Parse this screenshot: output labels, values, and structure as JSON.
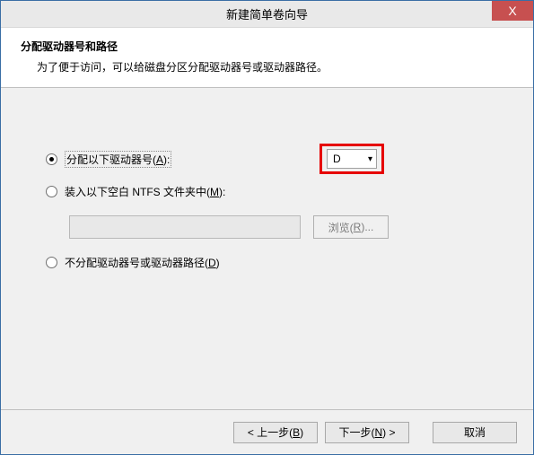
{
  "window": {
    "title": "新建简单卷向导",
    "close_glyph": "X"
  },
  "header": {
    "title": "分配驱动器号和路径",
    "subtitle": "为了便于访问，可以给磁盘分区分配驱动器号或驱动器路径。"
  },
  "options": {
    "assign_letter": {
      "label_pre": "分配以下驱动器号(",
      "hotkey": "A",
      "label_post": "):",
      "checked": true
    },
    "mount_folder": {
      "label_pre": "装入以下空白 NTFS 文件夹中(",
      "hotkey": "M",
      "label_post": "):",
      "checked": false
    },
    "no_assign": {
      "label_pre": "不分配驱动器号或驱动器路径(",
      "hotkey": "D",
      "label_post": ")",
      "checked": false
    }
  },
  "drive_select": {
    "value": "D"
  },
  "path_input": {
    "value": ""
  },
  "browse": {
    "label_pre": "浏览(",
    "hotkey": "R",
    "label_post": ")..."
  },
  "buttons": {
    "back": {
      "pre": "< 上一步(",
      "hotkey": "B",
      "post": ")"
    },
    "next": {
      "pre": "下一步(",
      "hotkey": "N",
      "post": ") >"
    },
    "cancel": {
      "label": "取消"
    }
  },
  "highlight_color": "#e60000"
}
